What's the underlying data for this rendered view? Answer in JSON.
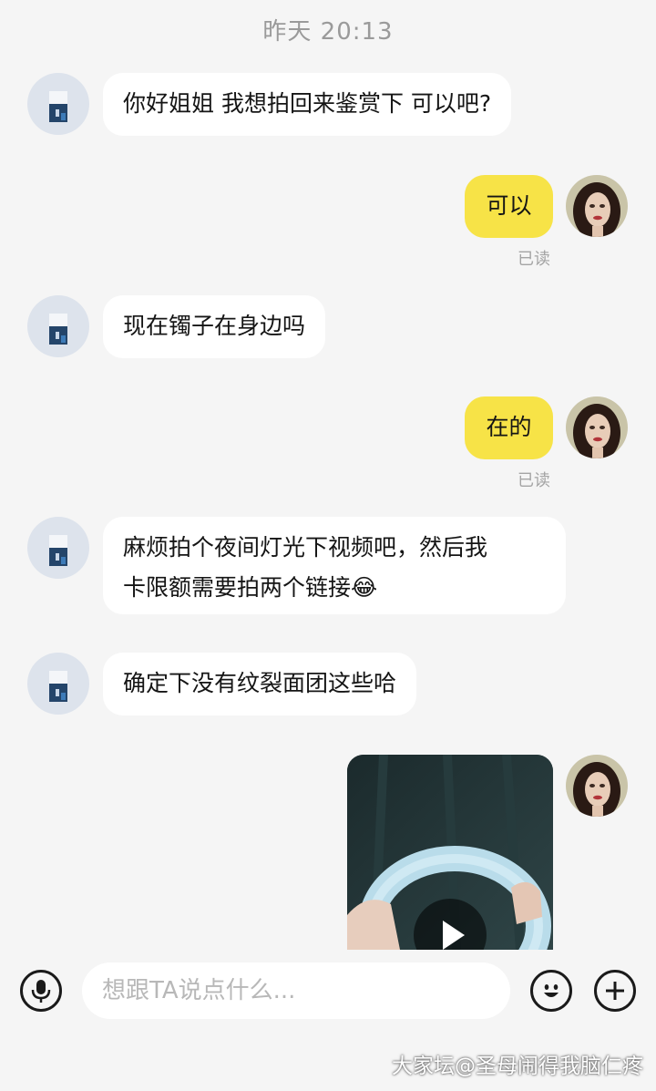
{
  "chat": {
    "timestamp": "昨天  20:13",
    "messages": [
      {
        "side": "in",
        "text": "你好姐姐 我想拍回来鉴赏下 可以吧?"
      },
      {
        "side": "out",
        "text": "可以",
        "status": "已读"
      },
      {
        "side": "in",
        "text": "现在镯子在身边吗"
      },
      {
        "side": "out",
        "text": "在的",
        "status": "已读"
      },
      {
        "side": "in",
        "text_line1": "麻烦拍个夜间灯光下视频吧，然后我",
        "text_line2": "卡限额需要拍两个链接",
        "emoji": "😂"
      },
      {
        "side": "in",
        "text": "确定下没有纹裂面团这些哈"
      },
      {
        "side": "out",
        "type": "video"
      }
    ]
  },
  "input": {
    "placeholder": "想跟TA说点什么...",
    "left_icon": "microphone-icon",
    "right_icons": [
      "emoji-icon",
      "plus-icon"
    ]
  },
  "watermark": "大家坛@圣母闹得我脑仁疼",
  "colors": {
    "background": "#f5f5f5",
    "incoming_bubble": "#ffffff",
    "outgoing_bubble": "#f7e347",
    "read_status": "#a4a4a4"
  }
}
